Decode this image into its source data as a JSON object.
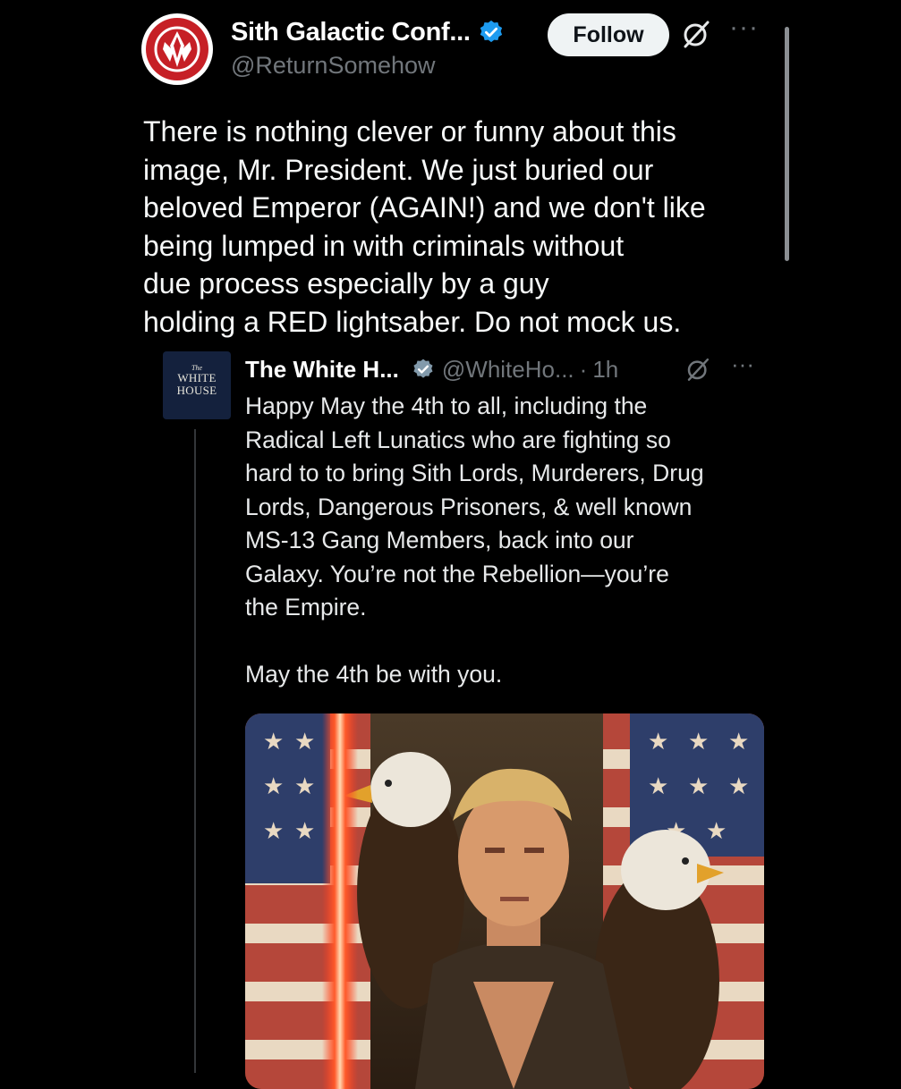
{
  "post": {
    "author": {
      "display_name": "Sith Galactic Conf...",
      "handle": "@ReturnSomehow",
      "verified": true
    },
    "follow_label": "Follow",
    "text": "There is nothing clever or funny about this\nimage, Mr. President. We just buried our\nbeloved Emperor (AGAIN!) and we don't like\nbeing lumped in with criminals without\ndue process especially by a guy\nholding a RED lightsaber. Do not mock us."
  },
  "quoted": {
    "author": {
      "display_name": "The White H...",
      "handle": "@WhiteHo...",
      "verified": true,
      "avatar_text_small": "The",
      "avatar_text_line1": "WHITE",
      "avatar_text_line2": "HOUSE"
    },
    "separator": "·",
    "time": "1h",
    "text": "Happy May the 4th to all, including the\nRadical Left Lunatics who are fighting so\nhard to to bring Sith Lords, Murderers, Drug\nLords, Dangerous Prisoners, & well known\nMS-13 Gang Members, back into our\nGalaxy. You’re not the Rebellion—you’re\nthe Empire.\n\nMay the 4th be with you."
  },
  "icons": {
    "verified": "verified-badge-icon",
    "grok": "grok-icon",
    "more": "more-icon"
  },
  "colors": {
    "background": "#000000",
    "verified_blue": "#1d9bf0",
    "verified_gray": "#829aab",
    "secondary_text": "#71767b",
    "sith_red": "#c62026"
  }
}
